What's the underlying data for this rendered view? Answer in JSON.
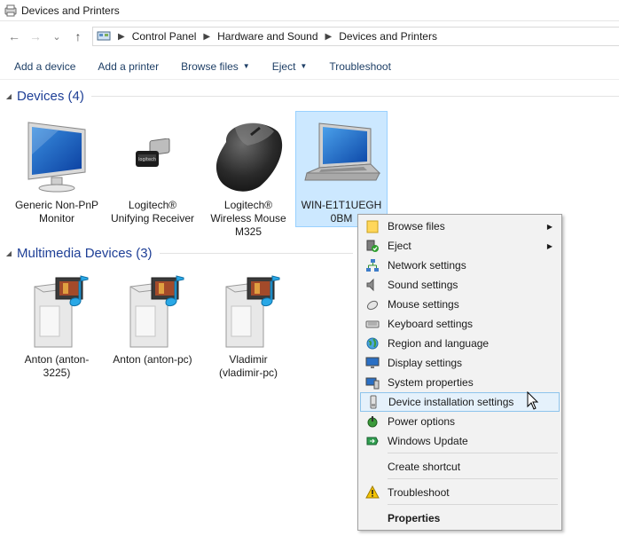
{
  "window": {
    "title": "Devices and Printers",
    "icon": "devices-printers-icon"
  },
  "nav": {
    "back": "←",
    "forward": "→",
    "recent": "⌄",
    "up": "↑"
  },
  "breadcrumb": [
    "Control Panel",
    "Hardware and Sound",
    "Devices and Printers"
  ],
  "toolbar": {
    "add_device": "Add a device",
    "add_printer": "Add a printer",
    "browse_files": "Browse files",
    "eject": "Eject",
    "troubleshoot": "Troubleshoot"
  },
  "groups": {
    "devices": {
      "title": "Devices (4)"
    },
    "multimedia": {
      "title": "Multimedia Devices (3)"
    }
  },
  "devices": [
    {
      "label": "Generic Non-PnP Monitor",
      "icon": "monitor-icon"
    },
    {
      "label": "Logitech® Unifying Receiver",
      "icon": "usb-receiver-icon"
    },
    {
      "label": "Logitech® Wireless Mouse M325",
      "icon": "mouse-icon"
    },
    {
      "label": "WIN-E1T1UEGH0BM",
      "icon": "laptop-icon",
      "selected": true
    }
  ],
  "multimedia": [
    {
      "label": "Anton (anton-3225)",
      "icon": "media-server-icon"
    },
    {
      "label": "Anton (anton-pc)",
      "icon": "media-server-icon"
    },
    {
      "label": "Vladimir (vladimir-pc)",
      "icon": "media-server-icon"
    }
  ],
  "context_menu": {
    "items": [
      {
        "label": "Browse files",
        "icon": "folder-icon",
        "submenu": true
      },
      {
        "label": "Eject",
        "icon": "eject-icon",
        "submenu": true
      },
      {
        "label": "Network settings",
        "icon": "network-icon"
      },
      {
        "label": "Sound settings",
        "icon": "speaker-icon"
      },
      {
        "label": "Mouse settings",
        "icon": "mouse-small-icon"
      },
      {
        "label": "Keyboard settings",
        "icon": "keyboard-icon"
      },
      {
        "label": "Region and language",
        "icon": "globe-icon"
      },
      {
        "label": "Display settings",
        "icon": "display-icon"
      },
      {
        "label": "System properties",
        "icon": "system-icon"
      },
      {
        "label": "Device installation settings",
        "icon": "device-install-icon",
        "highlighted": true
      },
      {
        "label": "Power options",
        "icon": "power-icon"
      },
      {
        "label": "Windows Update",
        "icon": "update-icon"
      },
      {
        "label": "Create shortcut"
      },
      {
        "label": "Troubleshoot",
        "icon": "warning-icon"
      },
      {
        "label": "Properties",
        "bold": true
      }
    ],
    "submenu_arrow": "▶"
  },
  "colors": {
    "selection_bg": "#cce8ff",
    "selection_border": "#99d1ff",
    "menu_bg": "#f2f2f2",
    "menu_highlight": "#e5f1fb",
    "link": "#1e3f66",
    "group_title": "#1e3f96"
  }
}
